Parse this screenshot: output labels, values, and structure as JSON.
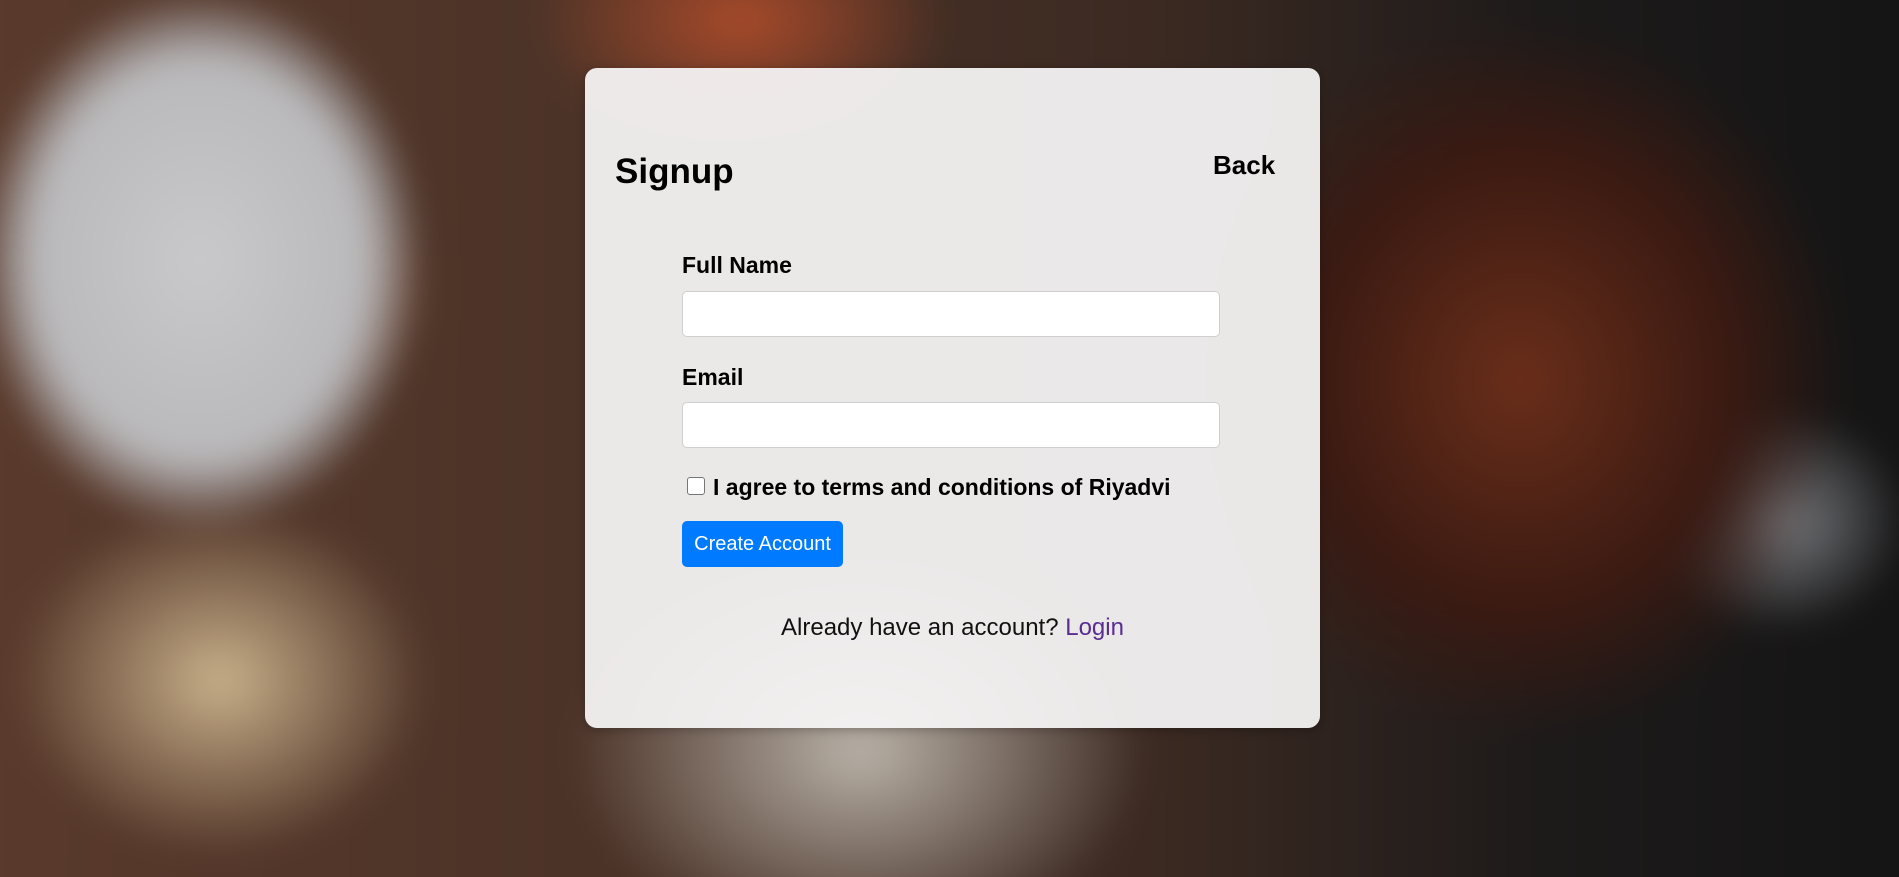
{
  "signup": {
    "title": "Signup",
    "back_label": "Back",
    "full_name_label": "Full Name",
    "full_name_value": "",
    "email_label": "Email",
    "email_value": "",
    "agree_label": "I agree to terms and conditions of Riyadvi",
    "agree_checked": false,
    "create_button_label": "Create Account",
    "footer_text": "Already have an account?",
    "login_link_label": "Login"
  },
  "colors": {
    "primary_button": "#007bff",
    "link": "#5a2d91",
    "card_background": "#f5f4f4"
  },
  "icons": {
    "checkbox": "checkbox-unchecked-icon"
  }
}
